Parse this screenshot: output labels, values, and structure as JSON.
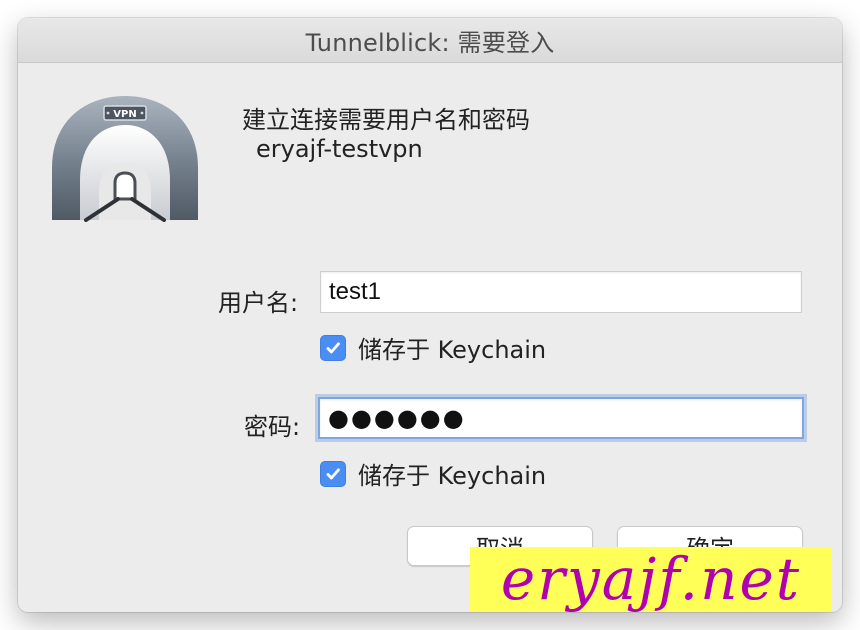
{
  "window": {
    "title": "Tunnelblick: 需要登入"
  },
  "icon": {
    "name": "vpn-tunnel-icon",
    "label": "VPN"
  },
  "message": {
    "title": "建立连接需要用户名和密码",
    "connection_name": "eryajf-testvpn"
  },
  "form": {
    "username": {
      "label": "用户名:",
      "value": "test1",
      "save_label": "储存于 Keychain",
      "save_checked": true
    },
    "password": {
      "label": "密码:",
      "display_value": "●●●●●●",
      "save_label": "储存于 Keychain",
      "save_checked": true
    }
  },
  "buttons": {
    "cancel": "取消",
    "ok": "确定"
  },
  "watermark": {
    "text": "eryajf.net",
    "text_color": "#b000b0",
    "background_color": "#ffff58"
  }
}
